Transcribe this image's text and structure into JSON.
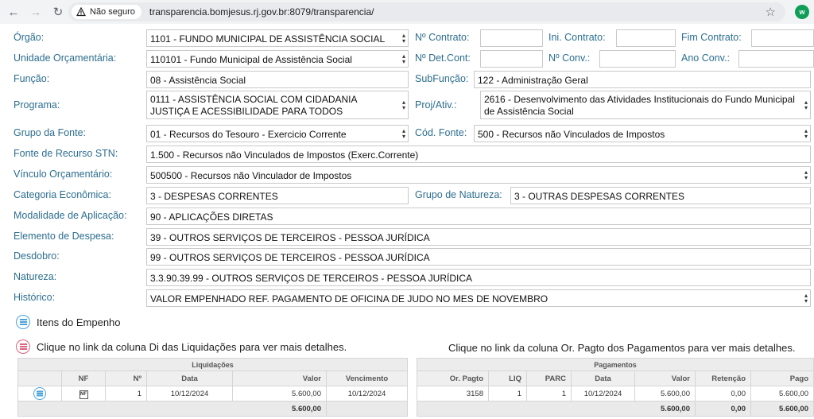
{
  "browser": {
    "security_label": "Não seguro",
    "url": "transparencia.bomjesus.rj.gov.br:8079/transparencia/",
    "profile_initial": "w"
  },
  "form": {
    "orgao": {
      "label": "Órgão:",
      "value": "1101 - FUNDO MUNICIPAL DE ASSISTÊNCIA SOCIAL"
    },
    "n_contrato": {
      "label": "Nº Contrato:",
      "value": ""
    },
    "ini_contrato": {
      "label": "Ini. Contrato:",
      "value": ""
    },
    "fim_contrato": {
      "label": "Fim Contrato:",
      "value": ""
    },
    "unidade": {
      "label": "Unidade Orçamentária:",
      "value": "110101 - Fundo Municipal de Assistência Social"
    },
    "n_det_cont": {
      "label": "Nº Det.Cont:",
      "value": ""
    },
    "n_conv": {
      "label": "Nº Conv.:",
      "value": ""
    },
    "ano_conv": {
      "label": "Ano Conv.:",
      "value": ""
    },
    "funcao": {
      "label": "Função:",
      "value": "08 - Assistência Social"
    },
    "subfuncao": {
      "label": "SubFunção:",
      "value": "122 - Administração Geral"
    },
    "programa": {
      "label": "Programa:",
      "value": "0111 - ASSISTÊNCIA SOCIAL COM CIDADANIA JUSTIÇA E ACESSIBILIDADE PARA TODOS"
    },
    "proj_ativ": {
      "label": "Proj/Ativ.:",
      "value": "2616 - Desenvolvimento das Atividades Institucionais do Fundo Municipal de Assistência Social"
    },
    "grupo_fonte": {
      "label": "Grupo da Fonte:",
      "value": "01 - Recursos do Tesouro - Exercicio Corrente"
    },
    "cod_fonte": {
      "label": "Cód. Fonte:",
      "value": "500 - Recursos não Vinculados de Impostos"
    },
    "fonte_stn": {
      "label": "Fonte de Recurso STN:",
      "value": "1.500 - Recursos não Vinculados de Impostos (Exerc.Corrente)"
    },
    "vinculo": {
      "label": "Vínculo Orçamentário:",
      "value": "500500 - Recursos não Vinculador de Impostos"
    },
    "categoria": {
      "label": "Categoria Econômica:",
      "value": "3 - DESPESAS CORRENTES"
    },
    "grupo_natureza": {
      "label": "Grupo de Natureza:",
      "value": "3 - OUTRAS DESPESAS CORRENTES"
    },
    "modalidade": {
      "label": "Modalidade de Aplicação:",
      "value": "90 - APLICAÇÕES DIRETAS"
    },
    "elemento": {
      "label": "Elemento de Despesa:",
      "value": "39 - OUTROS SERVIÇOS DE TERCEIROS - PESSOA JURÍDICA"
    },
    "desdobro": {
      "label": "Desdobro:",
      "value": "99 - OUTROS SERVIÇOS DE TERCEIROS - PESSOA JURÍDICA"
    },
    "natureza": {
      "label": "Natureza:",
      "value": "3.3.90.39.99 - OUTROS SERVIÇOS DE TERCEIROS - PESSOA JURÍDICA"
    },
    "historico": {
      "label": "Histórico:",
      "value": "VALOR EMPENHADO REF. PAGAMENTO DE OFICINA DE JUDO NO MES DE NOVEMBRO"
    }
  },
  "sections": {
    "itens_empenho": "Itens do Empenho",
    "liquidacoes_hint": "Clique no link da coluna Di das Liquidações para ver mais detalhes.",
    "pagamentos_hint": "Clique no link da coluna Or. Pagto dos Pagamentos para ver mais detalhes."
  },
  "liquidacoes": {
    "title": "Liquidações",
    "headers": {
      "nf": "NF",
      "n": "Nº",
      "data": "Data",
      "valor": "Valor",
      "vencimento": "Vencimento"
    },
    "rows": [
      {
        "nf_icon": "NF",
        "n": "1",
        "data": "10/12/2024",
        "valor": "5.600,00",
        "vencimento": "10/12/2024"
      }
    ],
    "total": "5.600,00"
  },
  "pagamentos": {
    "title": "Pagamentos",
    "headers": {
      "or_pagto": "Or. Pagto",
      "liq": "LIQ",
      "parc": "PARC",
      "data": "Data",
      "valor": "Valor",
      "retencao": "Retenção",
      "pago": "Pago"
    },
    "rows": [
      {
        "or_pagto": "3158",
        "liq": "1",
        "parc": "1",
        "data": "10/12/2024",
        "valor": "5.600,00",
        "retencao": "0,00",
        "pago": "5.600,00"
      }
    ],
    "totals": {
      "valor": "5.600,00",
      "retencao": "0,00",
      "pago": "5.600,00"
    }
  },
  "colors": {
    "label": "#2c6e8f",
    "accent_blue": "#4aa3df",
    "accent_red": "#e0607e"
  }
}
